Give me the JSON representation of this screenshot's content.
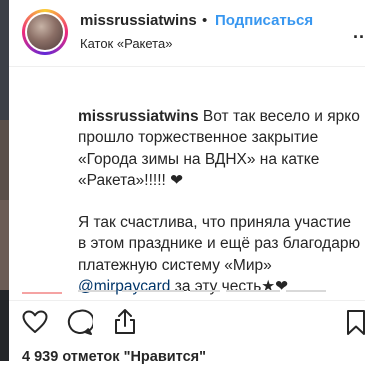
{
  "post": {
    "username": "missrussiatwins",
    "separator": "•",
    "follow_label": "Подписаться",
    "location": "Каток «Ракета»",
    "more_label": "..."
  },
  "caption": {
    "username": "missrussiatwins",
    "text1": " Вот так весело и ярко прошло торжественное закрытие «Города зимы на ВДНХ» на катке «Ракета»!!!!! ❤",
    "text2a": "Я так счастлива, что приняла участие в этом празднике и ещё раз благодарю платежную систему «Мир» ",
    "mention": "@mirpaycard",
    "text2b": " за эту честь★❤"
  },
  "actions": {
    "like_icon": "heart-icon",
    "comment_icon": "comment-icon",
    "share_icon": "share-icon",
    "save_icon": "bookmark-icon",
    "likes_text": "4 939 отметок \"Нравится\""
  },
  "colors": {
    "link": "#3897f0",
    "mention": "#003569",
    "text": "#262626"
  }
}
